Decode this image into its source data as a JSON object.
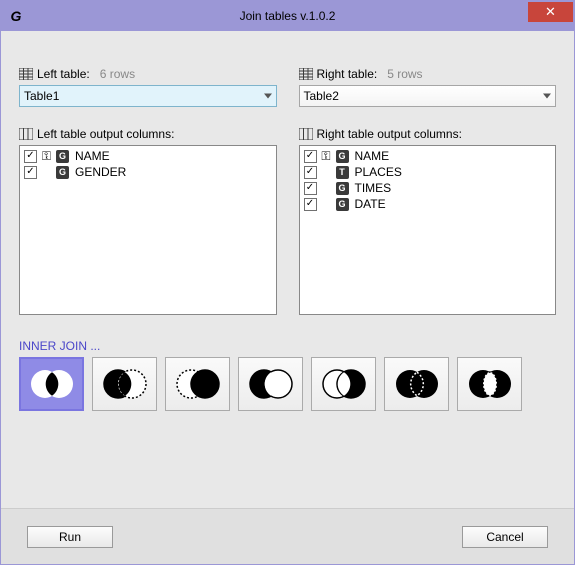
{
  "window": {
    "title": "Join tables v.1.0.2",
    "app_letter": "G",
    "close_glyph": "✕"
  },
  "left": {
    "label": "Left table:",
    "row_count": "6 rows",
    "selected": "Table1",
    "columns_label": "Left table output columns:",
    "columns": [
      {
        "name": "NAME",
        "type": "G",
        "key": true,
        "checked": true
      },
      {
        "name": "GENDER",
        "type": "G",
        "key": false,
        "checked": true
      }
    ]
  },
  "right": {
    "label": "Right table:",
    "row_count": "5 rows",
    "selected": "Table2",
    "columns_label": "Right table output columns:",
    "columns": [
      {
        "name": "NAME",
        "type": "G",
        "key": true,
        "checked": true
      },
      {
        "name": "PLACES",
        "type": "T",
        "key": false,
        "checked": true
      },
      {
        "name": "TIMES",
        "type": "G",
        "key": false,
        "checked": true
      },
      {
        "name": "DATE",
        "type": "G",
        "key": false,
        "checked": true
      }
    ]
  },
  "joins": {
    "label": "INNER JOIN ...",
    "selected": 0,
    "options": [
      {
        "name": "inner-join",
        "leftFill": "#fff",
        "rightFill": "#fff",
        "centerFill": "#000",
        "leftStroke": "none",
        "rightStroke": "none"
      },
      {
        "name": "left-join",
        "leftFill": "#000",
        "rightFill": "#fff",
        "centerFill": "#000",
        "leftStroke": "#000",
        "rightStroke": "#000",
        "rightDash": "2,2"
      },
      {
        "name": "right-join",
        "leftFill": "#fff",
        "rightFill": "#000",
        "centerFill": "#000",
        "leftStroke": "#000",
        "rightStroke": "#000",
        "leftDash": "2,2"
      },
      {
        "name": "left-only",
        "leftFill": "#000",
        "rightFill": "#fff",
        "centerFill": "#fff",
        "leftStroke": "#000",
        "rightStroke": "#000"
      },
      {
        "name": "right-only",
        "leftFill": "#fff",
        "rightFill": "#000",
        "centerFill": "#fff",
        "leftStroke": "#000",
        "rightStroke": "#000"
      },
      {
        "name": "outer-join",
        "leftFill": "#000",
        "rightFill": "#000",
        "centerFill": "#000",
        "leftStroke": "none",
        "rightStroke": "none",
        "centerDash": "2,2",
        "centerStroke": "#fff"
      },
      {
        "name": "outer-excl",
        "leftFill": "#000",
        "rightFill": "#000",
        "centerFill": "#fff",
        "leftStroke": "none",
        "rightStroke": "none",
        "centerDash": "2,2",
        "centerStroke": "#000",
        "centerMask": true
      }
    ]
  },
  "buttons": {
    "run": "Run",
    "cancel": "Cancel"
  },
  "glyphs": {
    "check": "✓",
    "key": "⚿"
  }
}
